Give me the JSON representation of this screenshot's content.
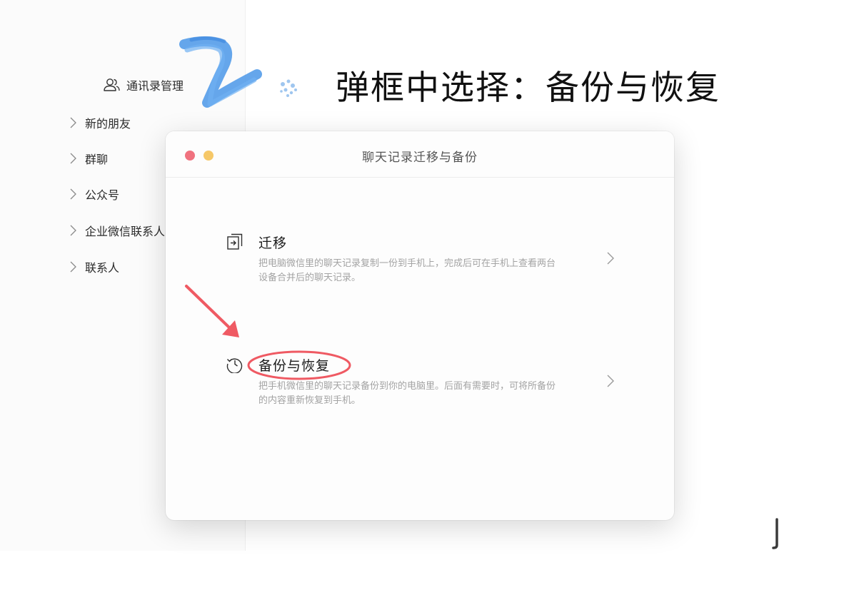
{
  "headline": "弹框中选择：备份与恢复",
  "sidebar": {
    "header": {
      "label": "通讯录管理",
      "icon": "contacts-icon"
    },
    "items": [
      {
        "label": "新的朋友",
        "icon": "chevron-right-icon"
      },
      {
        "label": "群聊",
        "icon": "chevron-right-icon"
      },
      {
        "label": "公众号",
        "icon": "chevron-right-icon"
      },
      {
        "label": "企业微信联系人",
        "icon": "chevron-right-icon"
      },
      {
        "label": "联系人",
        "icon": "chevron-right-icon"
      }
    ]
  },
  "dialog": {
    "title": "聊天记录迁移与备份",
    "options": [
      {
        "title": "迁移",
        "icon": "migrate-icon",
        "description": "把电脑微信里的聊天记录复制一份到手机上，完成后可在手机上查看两台设备合并后的聊天记录。"
      },
      {
        "title": "备份与恢复",
        "icon": "history-clock-icon",
        "description": "把手机微信里的聊天记录备份到你的电脑里。后面有需要时，可将所备份的内容重新恢复到手机。"
      }
    ]
  },
  "colors": {
    "annotation_red": "#ef5a63",
    "brush_blue": "#4a96e8",
    "close_dot": "#f0727f",
    "minimize_dot": "#f6c868",
    "desc_gray": "#a3a3a3"
  }
}
